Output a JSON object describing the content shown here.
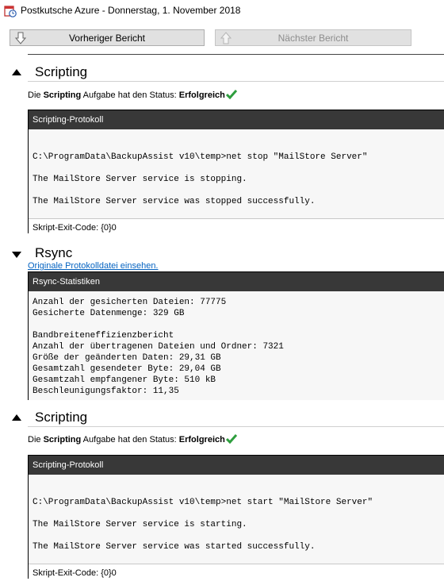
{
  "window": {
    "title": "Postkutsche Azure - Donnerstag, 1. November 2018",
    "app_icon": "calendar-clock-icon"
  },
  "nav": {
    "prev_label": "Vorheriger Bericht",
    "next_label": "Nächster Bericht",
    "prev_icon": "arrow-down-icon",
    "next_icon": "arrow-up-icon",
    "next_enabled": false
  },
  "sections": [
    {
      "heading": "Scripting",
      "expanded": true,
      "status": {
        "prefix": "Die ",
        "task": "Scripting",
        "middle": " Aufgabe hat den Status: ",
        "result": "Erfolgreich",
        "result_icon": "checkmark-icon"
      },
      "log": {
        "title": "Scripting-Protokoll",
        "lines": [
          "",
          "",
          "C:\\ProgramData\\BackupAssist v10\\temp>net stop \"MailStore Server\"",
          "",
          "The MailStore Server service is stopping.",
          "",
          "The MailStore Server service was stopped successfully.",
          ""
        ],
        "footer": "Skript-Exit-Code: {0}0"
      }
    },
    {
      "heading": "Rsync",
      "expanded": false,
      "link": "Originale Protokolldatei einsehen.",
      "stats": {
        "title": "Rsync-Statistiken",
        "lines": [
          "Anzahl der gesicherten Dateien: 77775",
          "Gesicherte Datenmenge: 329 GB",
          "",
          "Bandbreiteneffizienzbericht",
          "Anzahl der übertragenen Dateien und Ordner: 7321",
          "Größe der geänderten Daten: 29,31 GB",
          "Gesamtzahl gesendeter Byte: 29,04 GB",
          "Gesamtzahl empfangener Byte: 510 kB",
          "Beschleunigungsfaktor: 11,35"
        ]
      }
    },
    {
      "heading": "Scripting",
      "expanded": true,
      "status": {
        "prefix": "Die ",
        "task": "Scripting",
        "middle": " Aufgabe hat den Status: ",
        "result": "Erfolgreich",
        "result_icon": "checkmark-icon"
      },
      "log": {
        "title": "Scripting-Protokoll",
        "lines": [
          "",
          "",
          "C:\\ProgramData\\BackupAssist v10\\temp>net start \"MailStore Server\"",
          "",
          "The MailStore Server service is starting.",
          "",
          "The MailStore Server service was started successfully.",
          ""
        ],
        "footer": "Skript-Exit-Code: {0}0"
      }
    }
  ],
  "colors": {
    "log_header_bg": "#383838",
    "log_body_bg": "#f7f7f7",
    "success_green": "#2e9e3e",
    "link": "#0563c1"
  }
}
